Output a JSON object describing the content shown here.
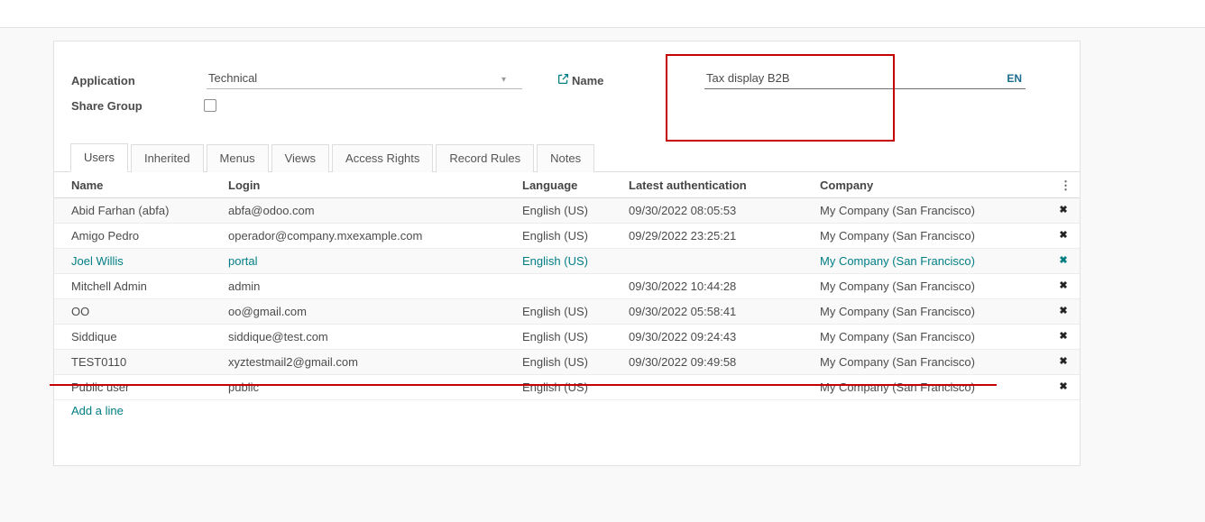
{
  "form": {
    "application_label": "Application",
    "application_value": "Technical",
    "name_label": "Name",
    "name_value": "Tax display B2B",
    "lang_badge": "EN",
    "share_group_label": "Share Group",
    "share_group_checked": false
  },
  "tabs": {
    "items": [
      {
        "label": "Users",
        "active": true
      },
      {
        "label": "Inherited",
        "active": false
      },
      {
        "label": "Menus",
        "active": false
      },
      {
        "label": "Views",
        "active": false
      },
      {
        "label": "Access Rights",
        "active": false
      },
      {
        "label": "Record Rules",
        "active": false
      },
      {
        "label": "Notes",
        "active": false
      }
    ]
  },
  "table": {
    "columns": [
      "Name",
      "Login",
      "Language",
      "Latest authentication",
      "Company"
    ],
    "rows": [
      {
        "name": "Abid Farhan (abfa)",
        "login": "abfa@odoo.com",
        "language": "English (US)",
        "latest_authentication": "09/30/2022 08:05:53",
        "company": "My Company (San Francisco)",
        "link_style": false,
        "struck": false
      },
      {
        "name": "Amigo Pedro",
        "login": "operador@company.mxexample.com",
        "language": "English (US)",
        "latest_authentication": "09/29/2022 23:25:21",
        "company": "My Company (San Francisco)",
        "link_style": false,
        "struck": false
      },
      {
        "name": "Joel Willis",
        "login": "portal",
        "language": "English (US)",
        "latest_authentication": "",
        "company": "My Company (San Francisco)",
        "link_style": true,
        "struck": false
      },
      {
        "name": "Mitchell Admin",
        "login": "admin",
        "language": "",
        "latest_authentication": "09/30/2022 10:44:28",
        "company": "My Company (San Francisco)",
        "link_style": false,
        "struck": false
      },
      {
        "name": "OO",
        "login": "oo@gmail.com",
        "language": "English (US)",
        "latest_authentication": "09/30/2022 05:58:41",
        "company": "My Company (San Francisco)",
        "link_style": false,
        "struck": false
      },
      {
        "name": "Siddique",
        "login": "siddique@test.com",
        "language": "English (US)",
        "latest_authentication": "09/30/2022 09:24:43",
        "company": "My Company (San Francisco)",
        "link_style": false,
        "struck": false
      },
      {
        "name": "TEST0110",
        "login": "xyztestmail2@gmail.com",
        "language": "English (US)",
        "latest_authentication": "09/30/2022 09:49:58",
        "company": "My Company (San Francisco)",
        "link_style": false,
        "struck": false
      },
      {
        "name": "Public user",
        "login": "public",
        "language": "English (US)",
        "latest_authentication": "",
        "company": "My Company (San Francisco)",
        "link_style": false,
        "struck": true
      }
    ],
    "add_line_label": "Add a line"
  },
  "icons": {
    "kebab": "⋮",
    "caret": "▾",
    "delete": "✖"
  },
  "colors": {
    "accent": "#017e84",
    "annotation": "#c40000"
  },
  "annotations": {
    "box_around": "Name field",
    "strike_through_row": "Public user"
  }
}
